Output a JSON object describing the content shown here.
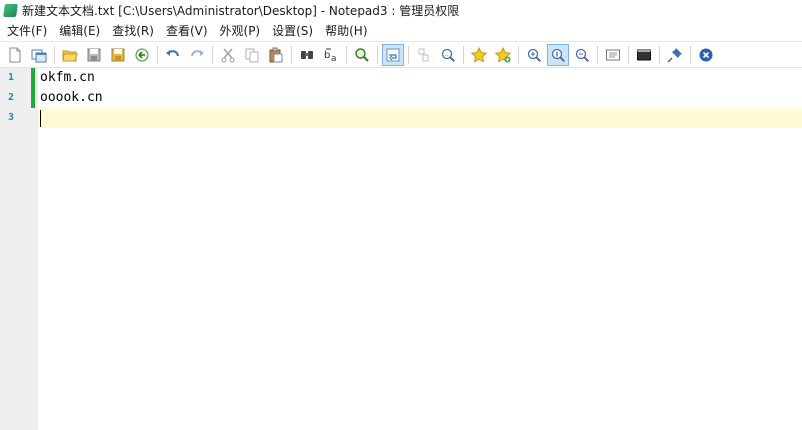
{
  "window": {
    "title": "新建文本文档.txt [C:\\Users\\Administrator\\Desktop] - Notepad3 : 管理员权限",
    "app_icon": "notepad3-icon"
  },
  "menu": [
    {
      "label": "文件(F)"
    },
    {
      "label": "编辑(E)"
    },
    {
      "label": "查找(R)"
    },
    {
      "label": "查看(V)"
    },
    {
      "label": "外观(P)"
    },
    {
      "label": "设置(S)"
    },
    {
      "label": "帮助(H)"
    }
  ],
  "toolbar": {
    "icons": [
      "new-file-icon",
      "new-window-icon",
      "open-folder-icon",
      "save-icon",
      "save-as-icon",
      "revert-icon",
      "undo-icon",
      "redo-icon",
      "cut-icon",
      "copy-icon",
      "paste-icon",
      "find-icon",
      "replace-icon",
      "goto-icon",
      "word-wrap-icon",
      "view-whitespace-icon",
      "zoom-find-icon",
      "favorites-icon",
      "add-favorite-icon",
      "zoom-in-icon",
      "zoom-reset-icon",
      "zoom-out-icon",
      "page-setup-icon",
      "console-icon",
      "pin-icon",
      "close-icon"
    ],
    "active": "word-wrap-icon"
  },
  "editor": {
    "lines": [
      {
        "number": "1",
        "text": "okfm.cn",
        "changed": true
      },
      {
        "number": "2",
        "text": "ooook.cn",
        "changed": true
      },
      {
        "number": "3",
        "text": "",
        "changed": false,
        "current": true
      }
    ],
    "colors": {
      "line_number": "#1b8bb8",
      "change_marker": "#1faa39",
      "current_line": "#fffbd7",
      "gutter": "#efefef"
    }
  }
}
